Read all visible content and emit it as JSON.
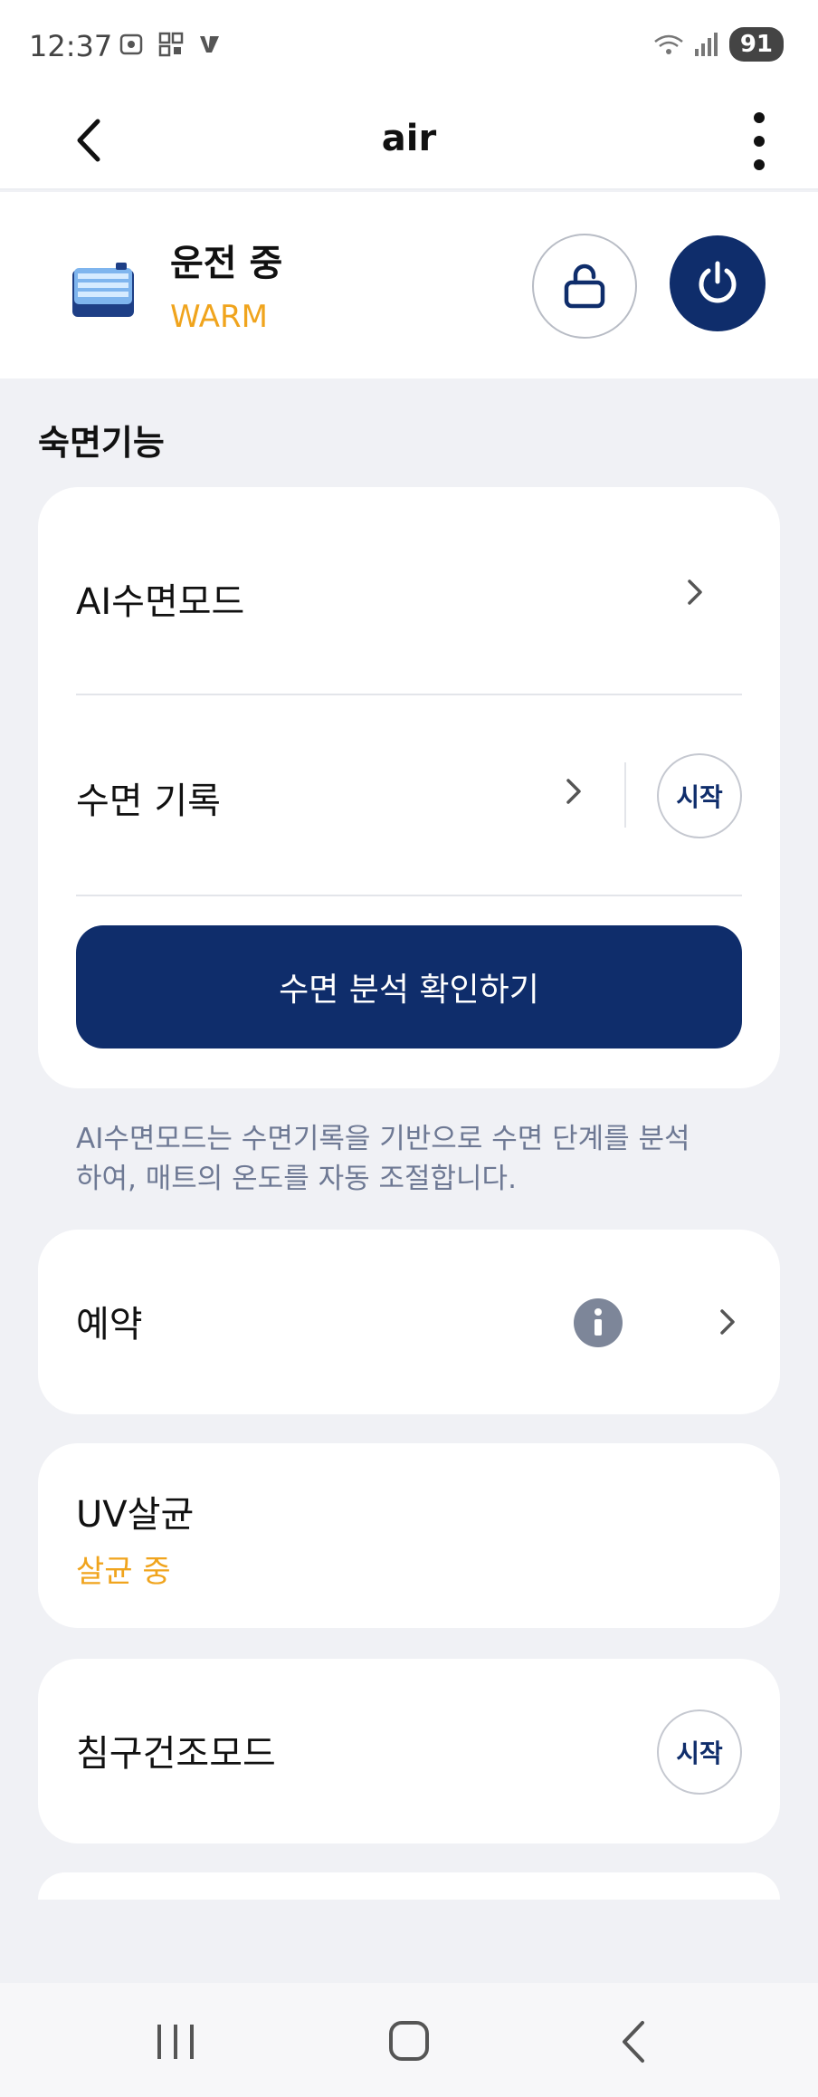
{
  "status_bar": {
    "time": "12:37",
    "battery": "91",
    "icons": [
      "screenshot-icon",
      "qr-icon",
      "vpn-icon",
      "wifi-icon",
      "signal-icon"
    ]
  },
  "app_bar": {
    "title": "air"
  },
  "device": {
    "state": "운전 중",
    "mode": "WARM",
    "mode_color": "#f0a41d"
  },
  "sleep_section": {
    "title": "숙면기능",
    "ai_sleep_mode": "AI수면모드",
    "sleep_record": "수면 기록",
    "sleep_record_start": "시작",
    "analysis_button": "수면 분석 확인하기",
    "note": "AI수면모드는 수면기록을 기반으로 수면 단계를 분석하여, 매트의 온도를 자동 조절합니다."
  },
  "reservation": {
    "label": "예약"
  },
  "uv": {
    "label": "UV살균",
    "status": "살균 중"
  },
  "bedding_dry": {
    "label": "침구건조모드",
    "start": "시작"
  },
  "colors": {
    "primary": "#0f2d6b",
    "accent": "#f0a41d",
    "background": "#f0f1f5"
  }
}
